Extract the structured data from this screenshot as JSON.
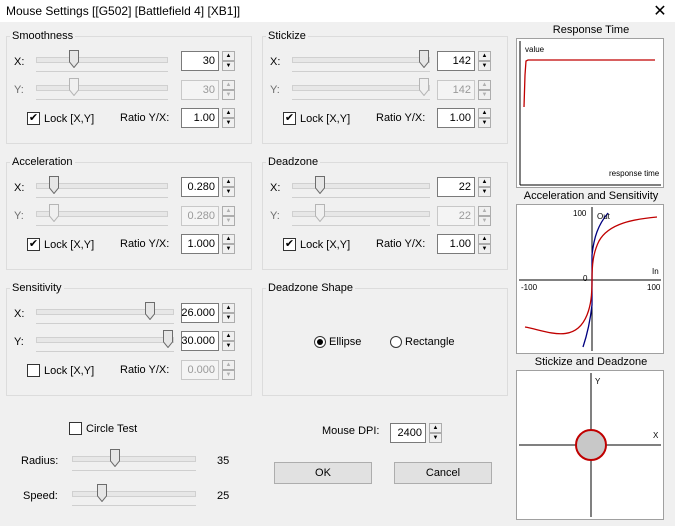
{
  "window": {
    "title": "Mouse Settings [[G502] [Battlefield 4] [XB1]]"
  },
  "smoothness": {
    "label": "Smoothness",
    "x_label": "X:",
    "y_label": "Y:",
    "x_value": "30",
    "y_value": "30",
    "lock_label": "Lock [X,Y]",
    "lock_checked": true,
    "ratio_label": "Ratio Y/X:",
    "ratio_value": "1.00"
  },
  "stickize": {
    "label": "Stickize",
    "x_label": "X:",
    "y_label": "Y:",
    "x_value": "142",
    "y_value": "142",
    "lock_label": "Lock [X,Y]",
    "lock_checked": true,
    "ratio_label": "Ratio Y/X:",
    "ratio_value": "1.00"
  },
  "acceleration": {
    "label": "Acceleration",
    "x_label": "X:",
    "y_label": "Y:",
    "x_value": "0.280",
    "y_value": "0.280",
    "lock_label": "Lock [X,Y]",
    "lock_checked": true,
    "ratio_label": "Ratio Y/X:",
    "ratio_value": "1.000"
  },
  "deadzone": {
    "label": "Deadzone",
    "x_label": "X:",
    "y_label": "Y:",
    "x_value": "22",
    "y_value": "22",
    "lock_label": "Lock [X,Y]",
    "lock_checked": true,
    "ratio_label": "Ratio Y/X:",
    "ratio_value": "1.00"
  },
  "sensitivity": {
    "label": "Sensitivity",
    "x_label": "X:",
    "y_label": "Y:",
    "x_value": "26.000",
    "y_value": "30.000",
    "lock_label": "Lock [X,Y]",
    "lock_checked": false,
    "ratio_label": "Ratio Y/X:",
    "ratio_value": "0.000"
  },
  "deadzone_shape": {
    "label": "Deadzone Shape",
    "ellipse_label": "Ellipse",
    "rectangle_label": "Rectangle",
    "selected": "Ellipse"
  },
  "circle_test": {
    "label": "Circle Test",
    "checked": false,
    "radius_label": "Radius:",
    "radius_value": "35",
    "speed_label": "Speed:",
    "speed_value": "25"
  },
  "mouse_dpi": {
    "label": "Mouse DPI:",
    "value": "2400"
  },
  "buttons": {
    "ok": "OK",
    "cancel": "Cancel"
  },
  "panels": {
    "response_time": {
      "title": "Response Time",
      "y_label": "value",
      "x_label": "response time"
    },
    "accel_sens": {
      "title": "Acceleration and Sensitivity",
      "y_label": "Out",
      "x_label": "In",
      "y_max": "100",
      "x_min": "-100",
      "x_max": "100",
      "zero": "0"
    },
    "stickize_deadzone": {
      "title": "Stickize and Deadzone",
      "y_label": "Y",
      "x_label": "X"
    }
  },
  "colors": {
    "curve_red": "#c00000",
    "curve_blue": "#000080",
    "circle_fill": "#c8c8c8"
  }
}
